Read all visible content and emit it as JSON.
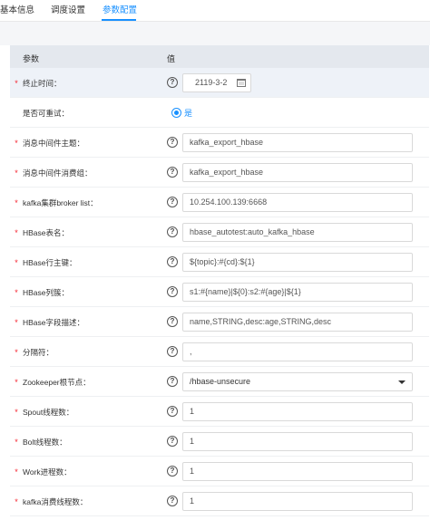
{
  "tabs": [
    {
      "label": "基本信息",
      "active": false
    },
    {
      "label": "调度设置",
      "active": false
    },
    {
      "label": "参数配置",
      "active": true
    }
  ],
  "table": {
    "header_param": "参数",
    "header_value": "值"
  },
  "rows": [
    {
      "required": true,
      "label": "终止时间：",
      "type": "date",
      "value": "2119-3-2",
      "help": "?"
    },
    {
      "required": false,
      "label": "是否可重试：",
      "type": "radio",
      "value": "是"
    },
    {
      "required": true,
      "label": "消息中间件主题：",
      "type": "text",
      "value": "kafka_export_hbase",
      "help": "?"
    },
    {
      "required": true,
      "label": "消息中间件消费组：",
      "type": "text",
      "value": "kafka_export_hbase",
      "help": "?"
    },
    {
      "required": true,
      "label": "kafka集群broker list：",
      "type": "text",
      "value": "10.254.100.139:6668",
      "help": "?"
    },
    {
      "required": true,
      "label": "HBase表名：",
      "type": "text",
      "value": "hbase_autotest:auto_kafka_hbase",
      "help": "?"
    },
    {
      "required": true,
      "label": "HBase行主键：",
      "type": "text",
      "value": "${topic}:#{cd}:${1}",
      "help": "?"
    },
    {
      "required": true,
      "label": "HBase列簇：",
      "type": "text",
      "value": "s1:#{name}|${0}:s2:#{age}|${1}",
      "help": "?"
    },
    {
      "required": true,
      "label": "HBase字段描述：",
      "type": "text",
      "value": "name,STRING,desc:age,STRING,desc",
      "help": "?"
    },
    {
      "required": true,
      "label": "分隔符：",
      "type": "text",
      "value": ",",
      "help": "?"
    },
    {
      "required": true,
      "label": "Zookeeper根节点：",
      "type": "select",
      "value": "/hbase-unsecure",
      "help": "?"
    },
    {
      "required": true,
      "label": "Spout线程数：",
      "type": "text",
      "value": "1",
      "help": "?"
    },
    {
      "required": true,
      "label": "Bolt线程数：",
      "type": "text",
      "value": "1",
      "help": "?"
    },
    {
      "required": true,
      "label": "Work进程数：",
      "type": "text",
      "value": "1",
      "help": "?"
    },
    {
      "required": true,
      "label": "kafka消费线程数：",
      "type": "text",
      "value": "1",
      "help": "?"
    }
  ],
  "colors": {
    "accent": "#1890ff",
    "required": "#f5222d",
    "header_bg": "#e4e8ee"
  }
}
